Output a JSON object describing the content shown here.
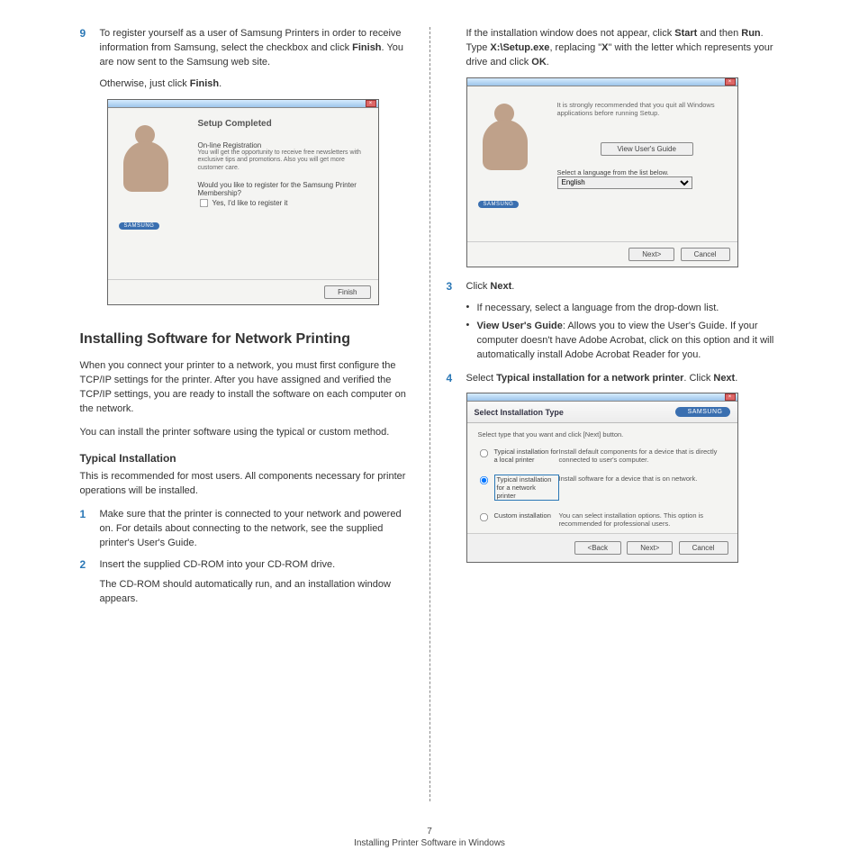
{
  "footer": {
    "page_number": "7",
    "chapter": "Installing Printer Software in Windows"
  },
  "left": {
    "step9_num": "9",
    "step9_p1a": "To register yourself as a user of Samsung Printers in order to receive information from Samsung, select the checkbox and click ",
    "step9_p1b": "Finish",
    "step9_p1c": ". You are now sent to the Samsung web site.",
    "step9_p2a": "Otherwise, just click ",
    "step9_p2b": "Finish",
    "step9_p2c": ".",
    "section_title": "Installing Software for Network Printing",
    "para1": "When you connect your printer to a network, you must first configure the TCP/IP settings for the printer. After you have assigned and verified the TCP/IP settings, you are ready to install the software on each computer on the network.",
    "para2": "You can install the printer software using the typical or custom method.",
    "subhead": "Typical Installation",
    "para3": "This is recommended for most users. All components necessary for printer operations will be installed.",
    "step1_num": "1",
    "step1": "Make sure that the printer is connected to your network and powered on. For details about connecting to the network, see the supplied printer's User's Guide.",
    "step2_num": "2",
    "step2a": "Insert the supplied CD-ROM into your CD-ROM drive.",
    "step2b": "The CD-ROM should automatically run, and an installation window appears."
  },
  "right": {
    "intro_a": "If the installation window does not appear, click ",
    "intro_b": "Start",
    "intro_c": " and then ",
    "intro_d": "Run",
    "intro_e": ". Type ",
    "intro_f": "X:\\Setup.exe",
    "intro_g": ", replacing \"",
    "intro_h": "X",
    "intro_i": "\" with the letter which represents your drive and click ",
    "intro_j": "OK",
    "intro_k": ".",
    "step3_num": "3",
    "step3_a": "Click ",
    "step3_b": "Next",
    "step3_c": ".",
    "bullet1": "If necessary, select a language from the drop-down list.",
    "bullet2_a": "View User's Guide",
    "bullet2_b": ": Allows you to view the User's Guide. If your computer doesn't have Adobe Acrobat, click on this option and it will automatically install Adobe Acrobat Reader for you.",
    "step4_num": "4",
    "step4_a": "Select ",
    "step4_b": "Typical installation for a network printer",
    "step4_c": ". Click ",
    "step4_d": "Next",
    "step4_e": "."
  },
  "mock1": {
    "title": "Setup Completed",
    "line1": "On-line Registration",
    "line2": "You will get the opportunity to receive free newsletters with exclusive tips and promotions. Also you will get more customer care.",
    "question": "Would you like to register for the Samsung Printer Membership?",
    "checkbox": "Yes, I'd like to register it",
    "brand": "SAMSUNG",
    "finish_btn": "Finish"
  },
  "mock2": {
    "recommend": "It is strongly recommended that you quit all Windows applications before running Setup.",
    "view_btn": "View User's Guide",
    "select_lang": "Select a language from the list below.",
    "lang": "English",
    "brand": "SAMSUNG",
    "next_btn": "Next>",
    "cancel_btn": "Cancel"
  },
  "mock3": {
    "header_title": "Select Installation Type",
    "brand": "SAMSUNG",
    "subtitle": "Select type that you want and click [Next] button.",
    "opt1_label": "Typical installation for a local printer",
    "opt1_desc": "Install default components for a device that is directly connected to user's computer.",
    "opt2_label": "Typical installation for a network printer",
    "opt2_desc": "Install software for a device that is on network.",
    "opt3_label": "Custom installation",
    "opt3_desc": "You can select installation options. This option is recommended for professional users.",
    "back_btn": "<Back",
    "next_btn": "Next>",
    "cancel_btn": "Cancel"
  }
}
